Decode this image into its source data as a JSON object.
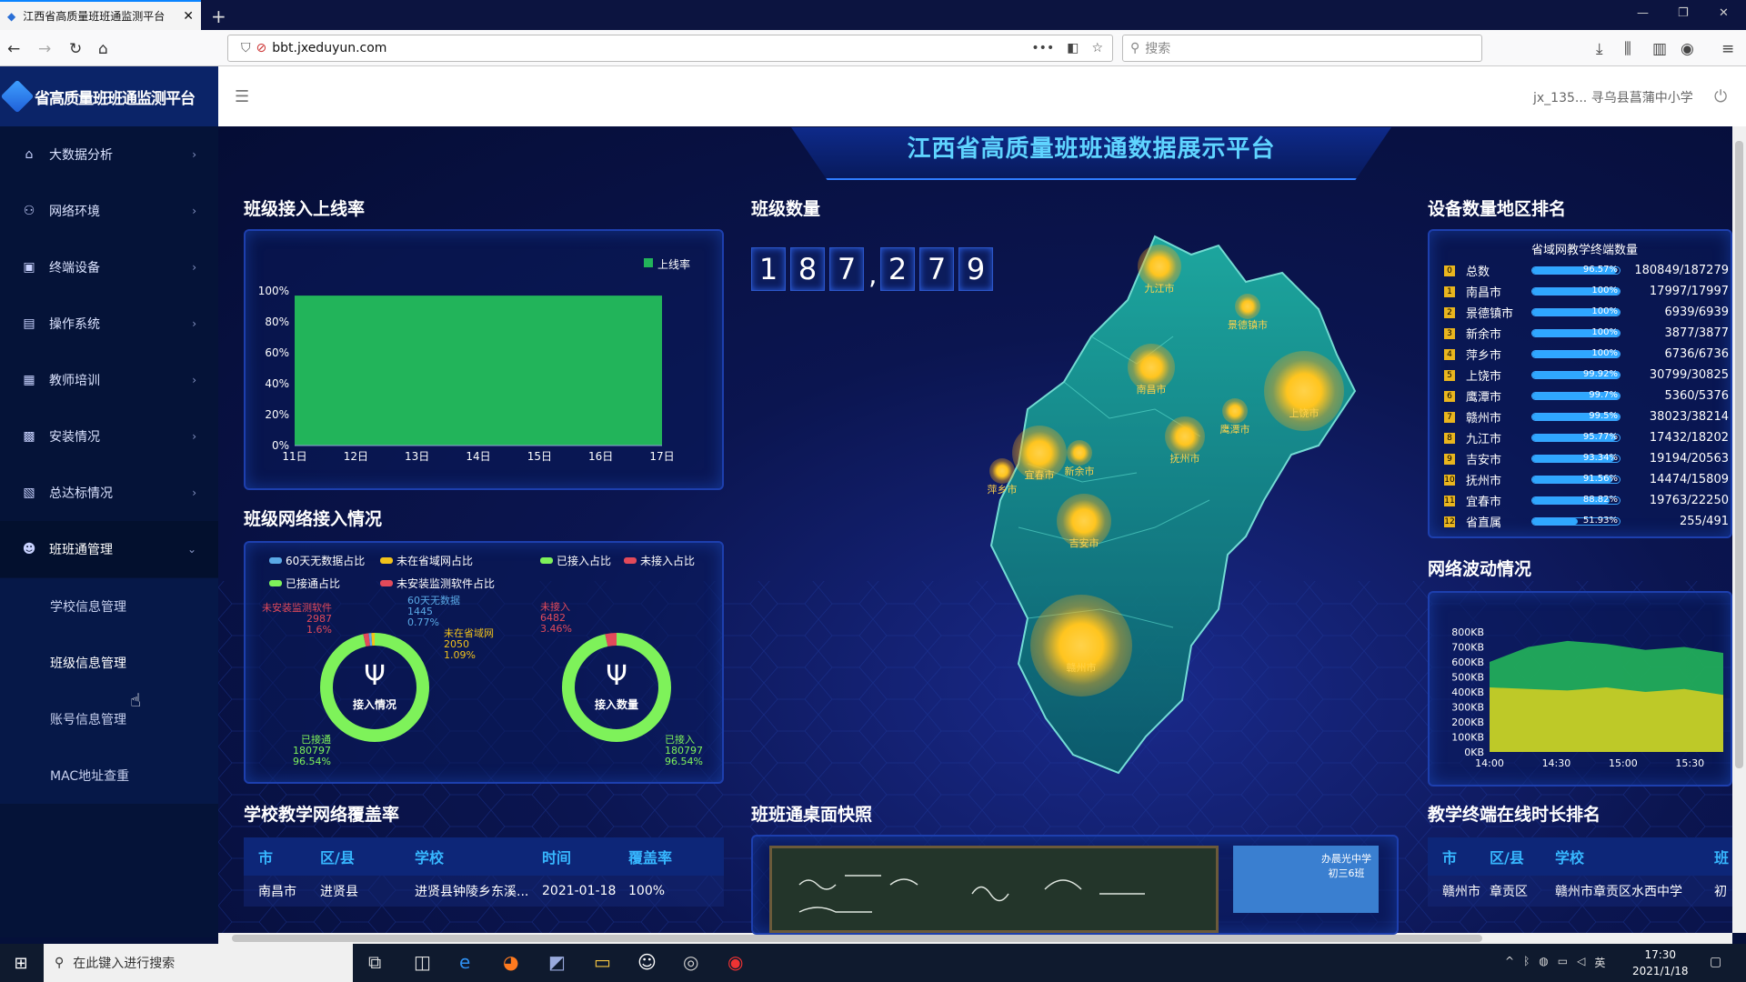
{
  "browser": {
    "tab_title": "江西省高质量班班通监测平台",
    "url_domain": "bbt.jxeduyun.com",
    "search_placeholder": "搜索",
    "tab_close": "✕",
    "new_tab": "+"
  },
  "app": {
    "logo_text": "省高质量班班通监测平台",
    "user_text": "jx_135...  寻乌县菖蒲中小学"
  },
  "sidebar": {
    "items": [
      {
        "label": "大数据分析",
        "icon": "home-icon"
      },
      {
        "label": "网络环境",
        "icon": "network-icon"
      },
      {
        "label": "终端设备",
        "icon": "device-icon"
      },
      {
        "label": "操作系统",
        "icon": "os-icon"
      },
      {
        "label": "教师培训",
        "icon": "training-icon"
      },
      {
        "label": "安装情况",
        "icon": "install-icon"
      },
      {
        "label": "总达标情况",
        "icon": "report-icon"
      },
      {
        "label": "班班通管理",
        "icon": "user-icon"
      }
    ],
    "subitems": [
      "学校信息管理",
      "班级信息管理",
      "账号信息管理",
      "MAC地址查重"
    ]
  },
  "dashboard": {
    "title": "江西省高质量班班通数据展示平台",
    "online_rate": {
      "title": "班级接入上线率",
      "legend": "上线率"
    },
    "network": {
      "title": "班级网络接入情况",
      "legend": [
        "60天无数据占比",
        "未在省域网占比",
        "已接入占比",
        "未接入占比",
        "已接通占比",
        "未安装监测软件占比"
      ],
      "donut1_center": "接入情况",
      "donut2_center": "接入数量",
      "d1_labels": {
        "nodata": [
          "60天无数据",
          "1445",
          "0.77%"
        ],
        "notinstalled": [
          "未安装监测软件",
          "2987",
          "1.6%"
        ],
        "notprov": [
          "未在省域网",
          "2050",
          "1.09%"
        ],
        "connected": [
          "已接通",
          "180797",
          "96.54%"
        ]
      },
      "d2_labels": {
        "notaccess": [
          "未接入",
          "6482",
          "3.46%"
        ],
        "access": [
          "已接入",
          "180797",
          "96.54%"
        ]
      }
    },
    "class_count": {
      "title": "班级数量",
      "digits": [
        "1",
        "8",
        "7",
        ",",
        "2",
        "7",
        "9"
      ]
    },
    "map_cities": [
      "九江市",
      "景德镇市",
      "南昌市",
      "上饶市",
      "鹰潭市",
      "抚州市",
      "新余市",
      "宜春市",
      "萍乡市",
      "吉安市",
      "赣州市"
    ],
    "ranking": {
      "title": "设备数量地区排名",
      "subtitle": "省域网教学终端数量",
      "rows": [
        {
          "badge": "0",
          "name": "总数",
          "pct": "96.57%",
          "val": "180849/187279",
          "fill": 0.9657
        },
        {
          "badge": "1",
          "name": "南昌市",
          "pct": "100%",
          "val": "17997/17997",
          "fill": 1.0
        },
        {
          "badge": "2",
          "name": "景德镇市",
          "pct": "100%",
          "val": "6939/6939",
          "fill": 1.0
        },
        {
          "badge": "3",
          "name": "新余市",
          "pct": "100%",
          "val": "3877/3877",
          "fill": 1.0
        },
        {
          "badge": "4",
          "name": "萍乡市",
          "pct": "100%",
          "val": "6736/6736",
          "fill": 1.0
        },
        {
          "badge": "5",
          "name": "上饶市",
          "pct": "99.92%",
          "val": "30799/30825",
          "fill": 0.9992
        },
        {
          "badge": "6",
          "name": "鹰潭市",
          "pct": "99.7%",
          "val": "5360/5376",
          "fill": 0.997
        },
        {
          "badge": "7",
          "name": "赣州市",
          "pct": "99.5%",
          "val": "38023/38214",
          "fill": 0.995
        },
        {
          "badge": "8",
          "name": "九江市",
          "pct": "95.77%",
          "val": "17432/18202",
          "fill": 0.9577
        },
        {
          "badge": "9",
          "name": "吉安市",
          "pct": "93.34%",
          "val": "19194/20563",
          "fill": 0.9334
        },
        {
          "badge": "10",
          "name": "抚州市",
          "pct": "91.56%",
          "val": "14474/15809",
          "fill": 0.9156
        },
        {
          "badge": "11",
          "name": "宜春市",
          "pct": "88.82%",
          "val": "19763/22250",
          "fill": 0.8882
        },
        {
          "badge": "12",
          "name": "省直属",
          "pct": "51.93%",
          "val": "255/491",
          "fill": 0.5193
        }
      ]
    },
    "wave": {
      "title": "网络波动情况"
    },
    "coverage": {
      "title": "学校教学网络覆盖率",
      "headers": [
        "市",
        "区/县",
        "学校",
        "时间",
        "覆盖率"
      ],
      "rows": [
        [
          "南昌市",
          "进贤县",
          "进贤县钟陵乡东溪...",
          "2021-01-18",
          "100%"
        ]
      ]
    },
    "snapshot": {
      "title": "班班通桌面快照",
      "thumb_text1": "办晨光中学",
      "thumb_text2": "初三6班"
    },
    "online_time": {
      "title": "教学终端在线时长排名",
      "headers": [
        "市",
        "区/县",
        "学校",
        "班"
      ],
      "rows": [
        [
          "赣州市",
          "章贡区",
          "赣州市章贡区水西中学",
          "初"
        ]
      ]
    }
  },
  "taskbar": {
    "search_placeholder": "在此键入进行搜索",
    "time": "17:30",
    "date": "2021/1/18",
    "ime": "英"
  },
  "chart_data": [
    {
      "type": "bar",
      "title": "班级接入上线率",
      "categories": [
        "11日",
        "12日",
        "13日",
        "14日",
        "15日",
        "16日",
        "17日"
      ],
      "series": [
        {
          "name": "上线率",
          "values": [
            97,
            97,
            97,
            97,
            97,
            97,
            97
          ]
        }
      ],
      "yticks": [
        "100%",
        "80%",
        "60%",
        "40%",
        "20%",
        "0%"
      ],
      "ylim": [
        0,
        100
      ],
      "color": "#22b45a"
    },
    {
      "type": "pie",
      "title": "接入情况",
      "slices": [
        {
          "label": "已接通",
          "value": 96.54,
          "color": "#7ef25a"
        },
        {
          "label": "未安装监测软件",
          "value": 1.6,
          "color": "#e24a5a"
        },
        {
          "label": "60天无数据",
          "value": 0.77,
          "color": "#5aa9e6"
        },
        {
          "label": "未在省域网",
          "value": 1.09,
          "color": "#f2c21b"
        }
      ]
    },
    {
      "type": "pie",
      "title": "接入数量",
      "slices": [
        {
          "label": "已接入",
          "value": 96.54,
          "color": "#7ef25a"
        },
        {
          "label": "未接入",
          "value": 3.46,
          "color": "#e24a5a"
        }
      ]
    },
    {
      "type": "area",
      "title": "网络波动情况",
      "x": [
        "14:00",
        "14:30",
        "15:00",
        "15:30"
      ],
      "yticks": [
        "800KB",
        "700KB",
        "600KB",
        "500KB",
        "400KB",
        "300KB",
        "200KB",
        "100KB",
        "0KB"
      ],
      "ylim": [
        0,
        800
      ],
      "series": [
        {
          "values": [
            600,
            700,
            740,
            720,
            680,
            700,
            660
          ]
        },
        {
          "values": [
            430,
            420,
            410,
            430,
            400,
            420,
            380
          ]
        }
      ]
    }
  ]
}
